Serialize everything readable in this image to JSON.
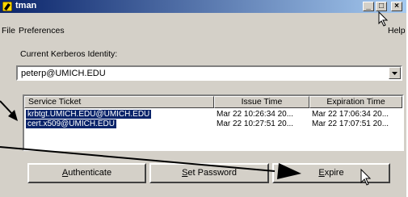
{
  "window": {
    "title": "tman",
    "minimize_label": "_",
    "maximize_label": "□",
    "close_label": "×"
  },
  "menu": {
    "file": "File",
    "preferences": "Preferences",
    "help": "Help"
  },
  "identity": {
    "label": "Current Kerberos Identity:",
    "value": "peterp@UMICH.EDU"
  },
  "tickets": {
    "columns": [
      "Service Ticket",
      "Issue Time",
      "Expiration Time"
    ],
    "rows": [
      {
        "service": "krbtgt.UMICH.EDU@UMICH.EDU",
        "issue": "Mar 22 10:26:34 20...",
        "expiration": "Mar 22 17:06:34 20..."
      },
      {
        "service": "cert.x509@UMICH.EDU",
        "issue": "Mar 22 10:27:51 20...",
        "expiration": "Mar 22 17:07:51 20..."
      }
    ]
  },
  "buttons": {
    "authenticate_first": "A",
    "authenticate_rest": "uthenticate",
    "set_password_first": "S",
    "set_password_rest": "et Password",
    "expire_first": "E",
    "expire_rest": "xpire"
  },
  "colors": {
    "selection": "#0a246a",
    "titlebar_start": "#0a246a",
    "face": "#d4d0c8"
  },
  "icons": [
    "app-icon",
    "chevron-down-icon",
    "mouse-cursor-icon",
    "annotation-arrow-icon"
  ]
}
